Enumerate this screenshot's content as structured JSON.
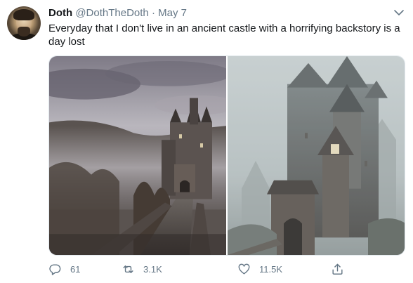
{
  "tweet": {
    "author_name": "Doth",
    "author_handle": "@DothTheDoth",
    "separator": "·",
    "date": "May 7",
    "text": "Everyday that I don't live in an ancient castle with a horrifying backstory is a day lost",
    "actions": {
      "replies": "61",
      "retweets": "3.1K",
      "likes": "11.5K"
    }
  },
  "icons": {
    "more": "chevron-down-icon",
    "reply": "reply-icon",
    "retweet": "retweet-icon",
    "like": "heart-icon",
    "share": "share-icon"
  },
  "colors": {
    "text": "#14171a",
    "secondary": "#657786",
    "border": "#e1e8ed"
  }
}
